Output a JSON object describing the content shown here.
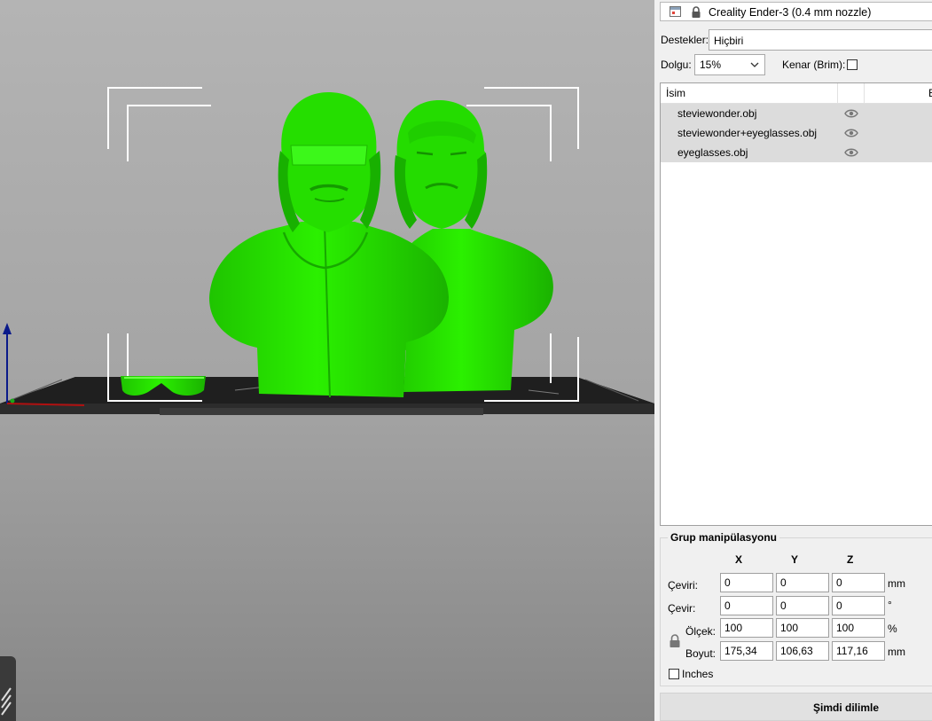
{
  "printer": {
    "name": "Creality Ender-3 (0.4 mm nozzle)"
  },
  "settings": {
    "supports_label": "Destekler:",
    "supports_value": "Hiçbiri",
    "infill_label": "Dolgu:",
    "infill_value": "15%",
    "brim_label": "Kenar (Brim):",
    "brim_checked": false
  },
  "object_list": {
    "header_name": "İsim",
    "header_trailing": "E",
    "items": [
      {
        "name": "steviewonder.obj",
        "visible": true
      },
      {
        "name": "steviewonder+eyeglasses.obj",
        "visible": true
      },
      {
        "name": "eyeglasses.obj",
        "visible": true
      }
    ]
  },
  "group": {
    "title": "Grup manipülasyonu",
    "axes": [
      "X",
      "Y",
      "Z"
    ],
    "rows": {
      "translate": {
        "label": "Çeviri:",
        "x": "0",
        "y": "0",
        "z": "0",
        "unit": "mm"
      },
      "rotate": {
        "label": "Çevir:",
        "x": "0",
        "y": "0",
        "z": "0",
        "unit": "°"
      },
      "scale": {
        "label": "Ölçek:",
        "x": "100",
        "y": "100",
        "z": "100",
        "unit": "%"
      },
      "size": {
        "label": "Boyut:",
        "x": "175,34",
        "y": "106,63",
        "z": "117,16",
        "unit": "mm"
      }
    },
    "inches_label": "Inches"
  },
  "slice_button": {
    "label": "Şimdi dilimle"
  },
  "colors": {
    "model": "#22e000",
    "bed": "#2a2a2a",
    "bg_top": "#b4b4b4",
    "bg_bottom": "#868686"
  }
}
